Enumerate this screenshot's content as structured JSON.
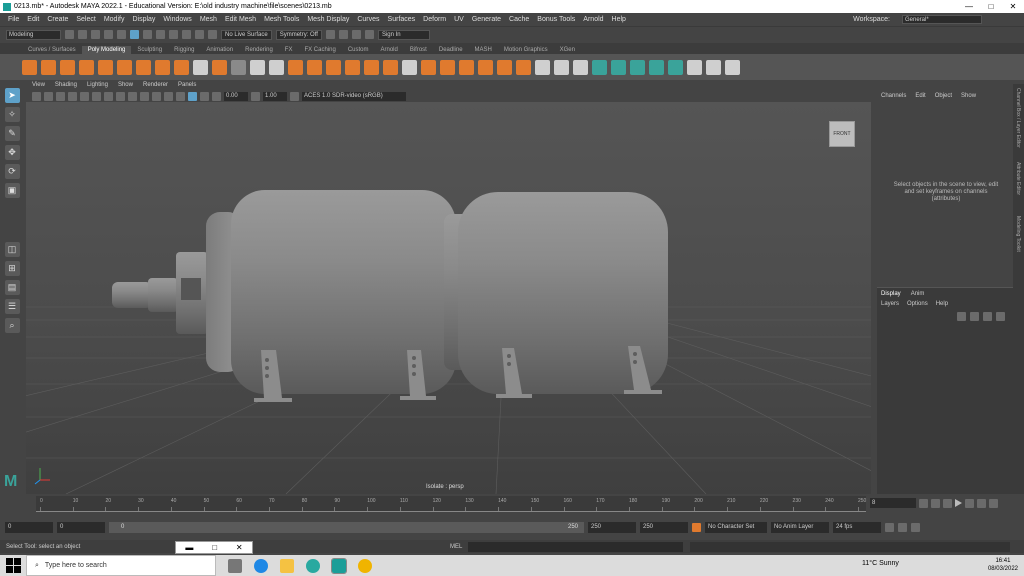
{
  "window": {
    "title": "0213.mb* - Autodesk MAYA 2022.1 - Educational Version: E:\\old industry machine\\file\\scenes\\0213.mb",
    "minimize": "—",
    "maximize": "□",
    "close": "✕"
  },
  "menubar": {
    "items": [
      "File",
      "Edit",
      "Create",
      "Select",
      "Modify",
      "Display",
      "Windows",
      "Mesh",
      "Edit Mesh",
      "Mesh Tools",
      "Mesh Display",
      "Curves",
      "Surfaces",
      "Deform",
      "UV",
      "Generate",
      "Cache",
      "Bonus Tools",
      "Arnold",
      "Help"
    ],
    "workspace_label": "Workspace:",
    "workspace_value": "General*"
  },
  "statusline": {
    "mode": "Modeling",
    "live_surface": "No Live Surface",
    "symmetry": "Symmetry: Off",
    "sign_in": "Sign In"
  },
  "shelf": {
    "tabs": [
      "Curves / Surfaces",
      "Poly Modeling",
      "Sculpting",
      "Rigging",
      "Animation",
      "Rendering",
      "FX",
      "FX Caching",
      "Custom",
      "Arnold",
      "Bifrost",
      "Deadline",
      "MASH",
      "Motion Graphics",
      "XGen"
    ],
    "active_tab": "Poly Modeling"
  },
  "viewport": {
    "menu": [
      "View",
      "Shading",
      "Lighting",
      "Show",
      "Renderer",
      "Panels"
    ],
    "field1": "0.00",
    "field2": "1.00",
    "color_space": "ACES 1.0 SDR-video (sRGB)",
    "view_cube": "FRONT",
    "camera_label": "Isolate : persp"
  },
  "channelbox": {
    "menu": [
      "Channels",
      "Edit",
      "Object",
      "Show"
    ],
    "message": "Select objects in the scene to view, edit and set keyframes on channels (attributes)",
    "layer_tabs": [
      "Display",
      "Anim"
    ],
    "layer_menu": [
      "Layers",
      "Options",
      "Help"
    ]
  },
  "sidetabs": [
    "Channel Box / Layer Editor",
    "Attribute Editor",
    "Modeling Toolkit"
  ],
  "timeslider": {
    "ticks": [
      "0",
      "10",
      "20",
      "30",
      "40",
      "50",
      "60",
      "70",
      "80",
      "90",
      "100",
      "110",
      "120",
      "130",
      "140",
      "150",
      "160",
      "170",
      "180",
      "190",
      "200",
      "210",
      "220",
      "230",
      "240",
      "250"
    ],
    "current_frame": "8"
  },
  "rangebar": {
    "start": "0",
    "start2": "0",
    "slider_start": "0",
    "slider_end": "250",
    "end": "250",
    "end2": "250",
    "character_set": "No Character Set",
    "anim_layer": "No Anim Layer",
    "fps": "24 fps"
  },
  "helpline": {
    "text": "Select Tool: select an object",
    "mel": "MEL"
  },
  "taskbar": {
    "search_placeholder": "Type here to search",
    "weather": "11°C  Sunny",
    "time": "16:41",
    "date": "08/03/2022"
  },
  "logo": "M",
  "colors": {
    "maya_teal": "#3aa39a",
    "shelf_orange": "#e07a2e",
    "selection_blue": "#5ea1c9"
  }
}
